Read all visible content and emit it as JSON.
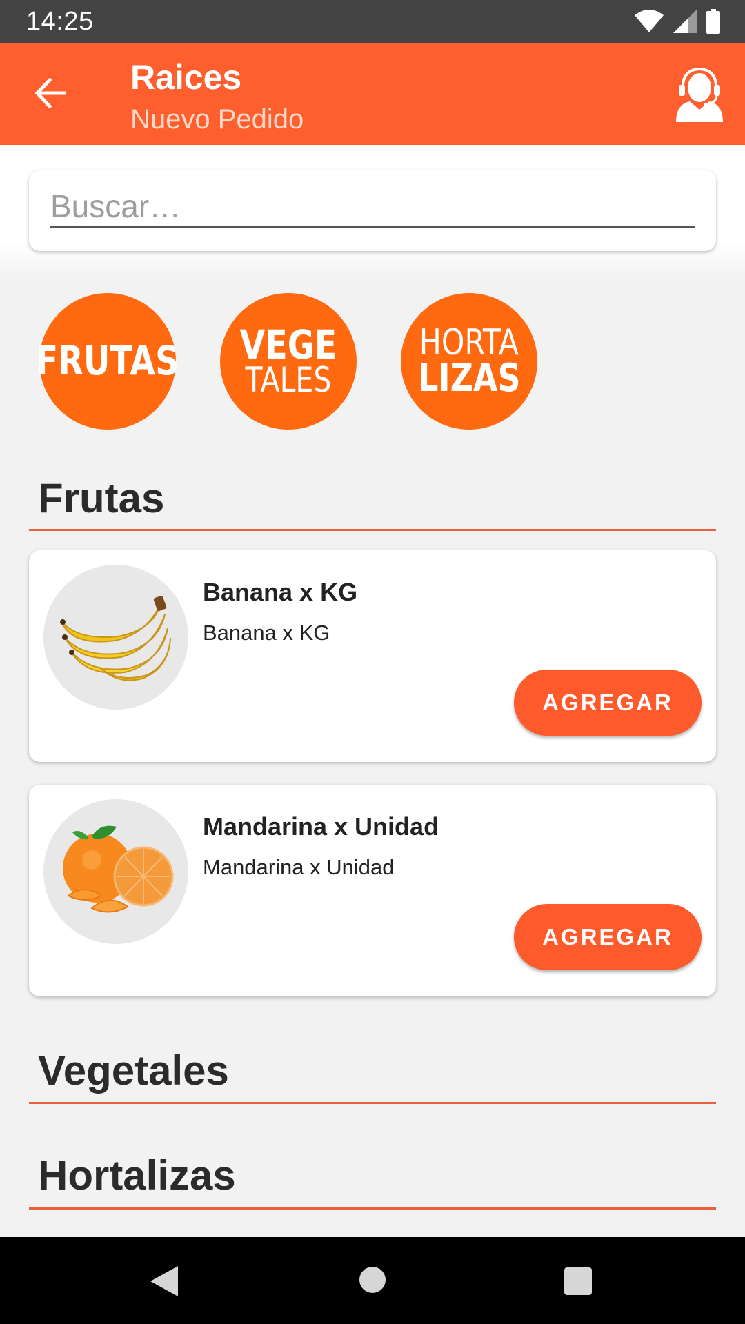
{
  "status_bar": {
    "time": "14:25",
    "icons": [
      "wifi-icon",
      "signal-icon",
      "battery-icon"
    ]
  },
  "app_bar": {
    "title": "Raices",
    "subtitle": "Nuevo Pedido",
    "back_icon": "arrow-left-icon",
    "support_icon": "support-agent-icon"
  },
  "search": {
    "placeholder": "Buscar…",
    "value": ""
  },
  "categories": [
    {
      "line1": "FRUTAS",
      "line2": ""
    },
    {
      "line1": "VEGE",
      "line2": "TALES"
    },
    {
      "line1": "HORTA",
      "line2": "LIZAS"
    }
  ],
  "sections": [
    {
      "title": "Frutas",
      "products": [
        {
          "name": "Banana x KG",
          "description": "Banana x KG",
          "button": "AGREGAR",
          "image": "banana-image"
        },
        {
          "name": "Mandarina x Unidad",
          "description": "Mandarina x Unidad",
          "button": "AGREGAR",
          "image": "mandarin-image"
        }
      ]
    },
    {
      "title": "Vegetales",
      "products": []
    },
    {
      "title": "Hortalizas",
      "products": []
    }
  ],
  "colors": {
    "primary": "#ff5f2e",
    "category": "#ff6a10",
    "divider": "#e8603c",
    "background": "#f2f2f2"
  },
  "nav_bar": {
    "icons": [
      "back-triangle-icon",
      "home-circle-icon",
      "recents-square-icon"
    ]
  }
}
